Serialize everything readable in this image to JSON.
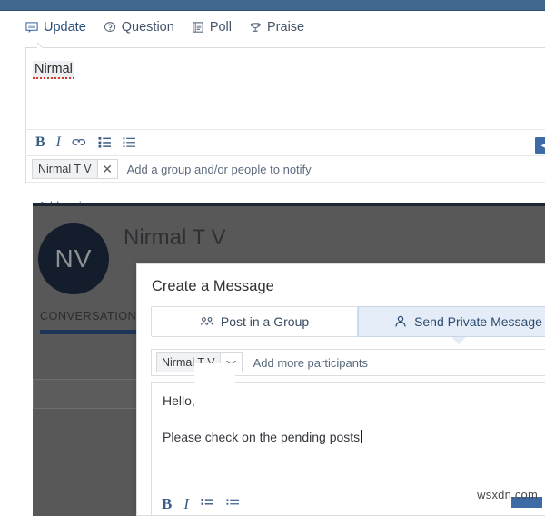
{
  "publisher": {
    "tabs": [
      {
        "label": "Update",
        "icon": "update-icon",
        "active": true
      },
      {
        "label": "Question",
        "icon": "question-icon",
        "active": false
      },
      {
        "label": "Poll",
        "icon": "poll-icon",
        "active": false
      },
      {
        "label": "Praise",
        "icon": "praise-trophy-icon",
        "active": false
      }
    ],
    "composer_text": "Nirmal",
    "format_buttons": [
      {
        "label": "B",
        "name": "bold"
      },
      {
        "label": "I",
        "name": "italic"
      },
      {
        "label": "link",
        "name": "link"
      },
      {
        "label": "ordered-list",
        "name": "ordered-list"
      },
      {
        "label": "bullet-list",
        "name": "bullet-list"
      }
    ],
    "notify": {
      "chip_label": "Nirmal T V",
      "remove_label": "✕",
      "placeholder": "Add a group and/or people to notify"
    },
    "add_topics_label": "Add topics",
    "submit_glyph": "◂"
  },
  "group_page": {
    "avatar_initials": "NV",
    "title": "Nirmal T V",
    "conversations_label": "CONVERSATIONS"
  },
  "dialog": {
    "title": "Create a Message",
    "tabs": [
      {
        "label": "Post in a Group",
        "icon": "group-people-icon",
        "active": false
      },
      {
        "label": "Send Private Message",
        "icon": "person-icon",
        "active": true
      }
    ],
    "participants": {
      "chip_label": "Nirmal T V",
      "caret_glyph": "⌄",
      "placeholder": "Add more participants"
    },
    "message": {
      "line1": "Hello,",
      "line2": "Please check on the pending posts"
    },
    "format_buttons": [
      {
        "label": "B",
        "name": "bold"
      },
      {
        "label": "I",
        "name": "italic"
      },
      {
        "label": "ordered-list",
        "name": "ordered-list"
      },
      {
        "label": "bullet-list",
        "name": "bullet-list"
      }
    ]
  },
  "watermark": "wsxdn.com",
  "colors": {
    "top_band": "#41688f",
    "accent_blue": "#3d6ba5",
    "active_tab_bg": "#e3ecf7",
    "scrim": "#585858",
    "avatar_bg": "#131d2c",
    "conversations_underline": "#1d3557"
  }
}
